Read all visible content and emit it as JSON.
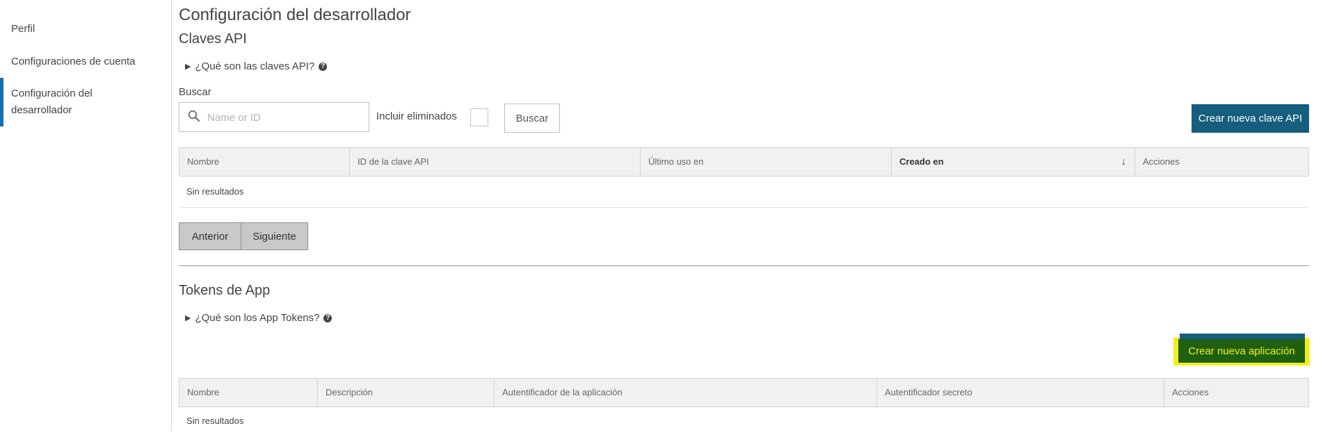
{
  "sidebar": {
    "items": [
      {
        "label": "Perfil"
      },
      {
        "label": "Configuraciones de cuenta"
      },
      {
        "label_line1": "Configuración del",
        "label_line2": "desarrollador"
      }
    ]
  },
  "page": {
    "title": "Configuración del desarrollador"
  },
  "api_keys": {
    "heading": "Claves API",
    "disclosure": "¿Qué son las claves API?",
    "search_label": "Buscar",
    "search_placeholder": "Name or ID",
    "include_deleted_label": "Incluir eliminados",
    "search_button": "Buscar",
    "create_button": "Crear nueva clave API",
    "columns": [
      "Nombre",
      "ID de la clave API",
      "Último uso en",
      "Creado en",
      "Acciones"
    ],
    "empty_text": "Sin resultados",
    "prev_button": "Anterior",
    "next_button": "Siguiente"
  },
  "app_tokens": {
    "heading": "Tokens de App",
    "disclosure": "¿Qué son los App Tokens?",
    "create_button": "Crear nueva aplicación",
    "columns": [
      "Nombre",
      "Descripción",
      "Autentificador de la aplicación",
      "Autentificador secreto",
      "Acciones"
    ],
    "empty_text": "Sin resultados"
  },
  "icons": {
    "search": "search-icon",
    "help": "help-circle-icon",
    "sort": "arrow-down-icon",
    "disclosure": "triangle-right-icon"
  },
  "colors": {
    "primary": "#155e7e",
    "nav_active": "#1a6fb0",
    "highlight": "#f4ef1a",
    "highlight_button_bg": "#1f6010",
    "highlight_button_text": "#f2f210"
  }
}
